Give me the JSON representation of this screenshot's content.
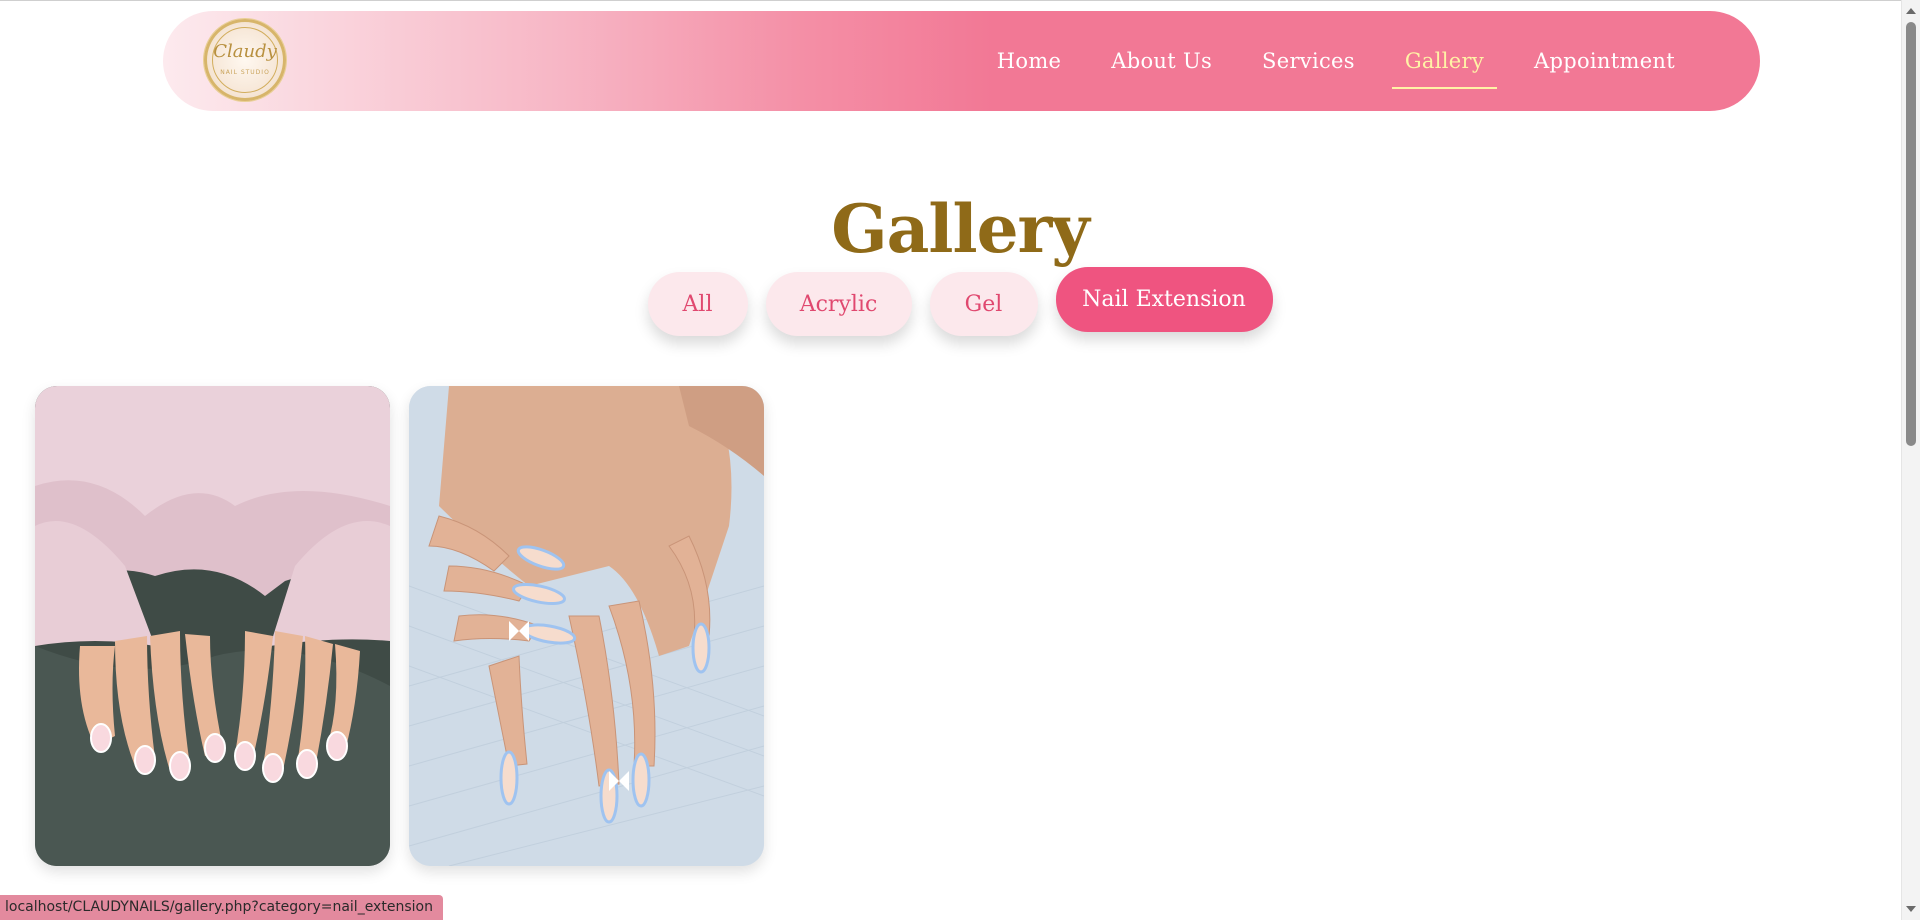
{
  "brand": {
    "logo_text": "Claudy",
    "logo_subtext": "NAIL STUDIO"
  },
  "nav": {
    "items": [
      {
        "label": "Home"
      },
      {
        "label": "About Us"
      },
      {
        "label": "Services"
      },
      {
        "label": "Gallery",
        "active": true
      },
      {
        "label": "Appointment"
      }
    ]
  },
  "page": {
    "title": "Gallery"
  },
  "filters": {
    "items": [
      {
        "label": "All"
      },
      {
        "label": "Acrylic"
      },
      {
        "label": "Gel"
      },
      {
        "label": "Nail Extension",
        "active": true
      }
    ]
  },
  "gallery": {
    "images": [
      {
        "description": "nail-extension-photo-pink-sweater"
      },
      {
        "description": "nail-extension-photo-blue-tips-bows"
      }
    ]
  },
  "status_bar": {
    "url": "localhost/CLAUDYNAILS/gallery.php?category=nail_extension"
  },
  "colors": {
    "nav_pink": "#f27895",
    "active_nav": "#fff3a6",
    "title_gold": "#8f6a18",
    "filter_bg": "#fce8ec",
    "filter_text": "#e0486f",
    "filter_active_bg": "#ef5480"
  }
}
